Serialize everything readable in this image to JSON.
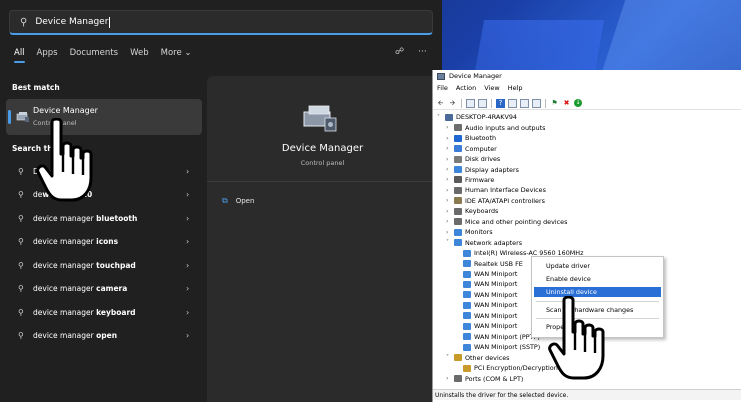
{
  "search": {
    "query": "Device Manager",
    "tabs": [
      "All",
      "Apps",
      "Documents",
      "Web",
      "More"
    ],
    "best_match_label": "Best match",
    "best_match": {
      "title": "Device Manager",
      "subtitle": "Control panel"
    },
    "web_section_label": "Search the",
    "results": [
      {
        "prefix": "De",
        "bold": "",
        "suffix": "",
        "muted": "ee web results"
      },
      {
        "prefix": "de",
        "bold": "windows 10",
        "suffix": "",
        "muted": ""
      },
      {
        "prefix": "device manager ",
        "bold": "bluetooth",
        "suffix": "",
        "muted": ""
      },
      {
        "prefix": "device manager ",
        "bold": "icons",
        "suffix": "",
        "muted": ""
      },
      {
        "prefix": "device manager ",
        "bold": "touchpad",
        "suffix": "",
        "muted": ""
      },
      {
        "prefix": "device manager ",
        "bold": "camera",
        "suffix": "",
        "muted": ""
      },
      {
        "prefix": "device manager ",
        "bold": "keyboard",
        "suffix": "",
        "muted": ""
      },
      {
        "prefix": "device manager ",
        "bold": "open",
        "suffix": "",
        "muted": ""
      }
    ],
    "preview": {
      "title": "Device Manager",
      "subtitle": "Control panel",
      "open_label": "Open"
    }
  },
  "device_manager": {
    "window_title": "Device Manager",
    "menu": [
      "File",
      "Action",
      "View",
      "Help"
    ],
    "tree": [
      {
        "label": "DESKTOP-4RAKV94",
        "expander": "v",
        "level": 0,
        "icon_color": "#4a6a9a"
      },
      {
        "label": "Audio inputs and outputs",
        "expander": ">",
        "level": 1,
        "icon_color": "#6d6d6d"
      },
      {
        "label": "Bluetooth",
        "expander": ">",
        "level": 1,
        "icon_color": "#1e66d0"
      },
      {
        "label": "Computer",
        "expander": ">",
        "level": 1,
        "icon_color": "#3c7bd6"
      },
      {
        "label": "Disk drives",
        "expander": ">",
        "level": 1,
        "icon_color": "#7a7a7a"
      },
      {
        "label": "Display adapters",
        "expander": ">",
        "level": 1,
        "icon_color": "#3d86d9"
      },
      {
        "label": "Firmware",
        "expander": ">",
        "level": 1,
        "icon_color": "#5a5a5a"
      },
      {
        "label": "Human Interface Devices",
        "expander": ">",
        "level": 1,
        "icon_color": "#6b6b6b"
      },
      {
        "label": "IDE ATA/ATAPI controllers",
        "expander": ">",
        "level": 1,
        "icon_color": "#8a7a50"
      },
      {
        "label": "Keyboards",
        "expander": ">",
        "level": 1,
        "icon_color": "#6b6b6b"
      },
      {
        "label": "Mice and other pointing devices",
        "expander": ">",
        "level": 1,
        "icon_color": "#6b6b6b"
      },
      {
        "label": "Monitors",
        "expander": ">",
        "level": 1,
        "icon_color": "#3d86d9"
      },
      {
        "label": "Network adapters",
        "expander": "v",
        "level": 1,
        "icon_color": "#3d86d9"
      },
      {
        "label": "Intel(R) Wireless-AC 9560 160MHz",
        "expander": "",
        "level": 2,
        "icon_color": "#3d86d9"
      },
      {
        "label": "Realtek USB FE",
        "expander": "",
        "level": 2,
        "icon_color": "#3d86d9"
      },
      {
        "label": "WAN Miniport",
        "expander": "",
        "level": 2,
        "icon_color": "#3d86d9"
      },
      {
        "label": "WAN Miniport",
        "expander": "",
        "level": 2,
        "icon_color": "#3d86d9"
      },
      {
        "label": "WAN Miniport",
        "expander": "",
        "level": 2,
        "icon_color": "#3d86d9"
      },
      {
        "label": "WAN Miniport",
        "expander": "",
        "level": 2,
        "icon_color": "#3d86d9"
      },
      {
        "label": "WAN Miniport",
        "expander": "",
        "level": 2,
        "icon_color": "#3d86d9"
      },
      {
        "label": "WAN Miniport",
        "expander": "",
        "level": 2,
        "icon_color": "#3d86d9"
      },
      {
        "label": "WAN Miniport (PPTP)",
        "expander": "",
        "level": 2,
        "icon_color": "#3d86d9"
      },
      {
        "label": "WAN Miniport (SSTP)",
        "expander": "",
        "level": 2,
        "icon_color": "#3d86d9"
      },
      {
        "label": "Other devices",
        "expander": "v",
        "level": 1,
        "icon_color": "#c89a2a"
      },
      {
        "label": "PCI Encryption/Decryption",
        "expander": "",
        "level": 2,
        "icon_color": "#c89a2a"
      },
      {
        "label": "Ports (COM & LPT)",
        "expander": ">",
        "level": 1,
        "icon_color": "#6b6b6b"
      }
    ],
    "context_menu": {
      "update": "Update driver",
      "enable": "Enable device",
      "uninstall": "Uninstall device",
      "scan": "Scan for hardware changes",
      "properties": "Properties"
    },
    "status_text": "Uninstalls the driver for the selected device."
  },
  "colors": {
    "accent": "#4a9be8",
    "menu_highlight": "#2a6fd6"
  }
}
